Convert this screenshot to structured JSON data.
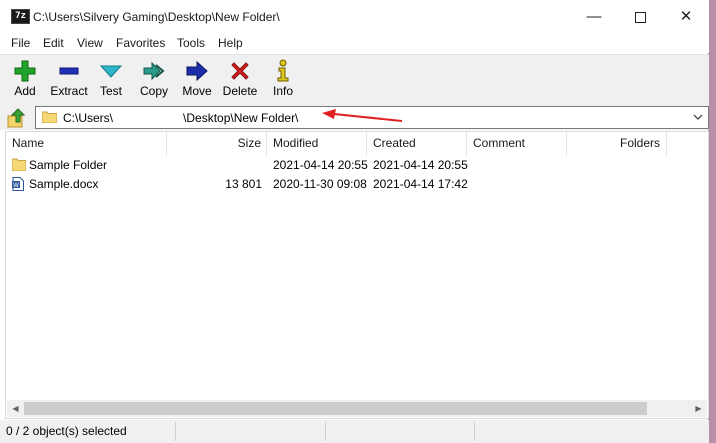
{
  "window": {
    "title": "C:\\Users\\Silvery Gaming\\Desktop\\New Folder\\",
    "app_icon_text": "7z"
  },
  "menu": [
    "File",
    "Edit",
    "View",
    "Favorites",
    "Tools",
    "Help"
  ],
  "toolbar": [
    {
      "label": "Add",
      "icon": "plus-icon",
      "color": "#1fa32a"
    },
    {
      "label": "Extract",
      "icon": "minus-icon",
      "color": "#1f2fb8"
    },
    {
      "label": "Test",
      "icon": "check-icon",
      "color": "#2eb6c8"
    },
    {
      "label": "Copy",
      "icon": "double-arrow-right-icon",
      "color": "#2a9a8a"
    },
    {
      "label": "Move",
      "icon": "arrow-right-icon",
      "color": "#1b2ea8"
    },
    {
      "label": "Delete",
      "icon": "x-icon",
      "color": "#d81e1e"
    },
    {
      "label": "Info",
      "icon": "info-icon",
      "color": "#e0c81a"
    }
  ],
  "address": {
    "path": "C:\\Users\\                     \\Desktop\\New Folder\\"
  },
  "columns": {
    "name": "Name",
    "size": "Size",
    "modified": "Modified",
    "created": "Created",
    "comment": "Comment",
    "folders": "Folders"
  },
  "files": [
    {
      "name": "Sample Folder",
      "type": "folder",
      "size": "",
      "modified": "2021-04-14 20:55",
      "created": "2021-04-14 20:55"
    },
    {
      "name": "Sample.docx",
      "type": "docx",
      "size": "13 801",
      "modified": "2020-11-30 09:08",
      "created": "2021-04-14 17:42"
    }
  ],
  "status": {
    "selection": "0 / 2 object(s) selected"
  },
  "colors": {
    "annotation_arrow": "#e02020",
    "desktop_bg": "#b98ea7"
  }
}
